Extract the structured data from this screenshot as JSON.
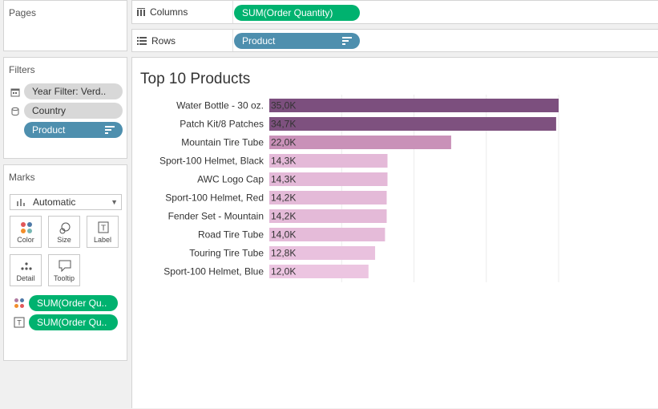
{
  "pages": {
    "title": "Pages"
  },
  "filters": {
    "title": "Filters",
    "items": [
      {
        "label": "Year Filter: Verd..",
        "icon": "calendar-filter-icon"
      },
      {
        "label": "Country",
        "icon": "database-icon"
      },
      {
        "label": "Product",
        "icon": "none",
        "sorted": true
      }
    ]
  },
  "marks": {
    "title": "Marks",
    "mark_type": "Automatic",
    "buttons": [
      {
        "label": "Color",
        "icon": "color-dots-icon"
      },
      {
        "label": "Size",
        "icon": "size-icon"
      },
      {
        "label": "Label",
        "icon": "label-icon"
      },
      {
        "label": "Detail",
        "icon": "detail-icon"
      },
      {
        "label": "Tooltip",
        "icon": "tooltip-icon"
      }
    ],
    "fields": [
      {
        "label": "SUM(Order Qu..",
        "icon": "color-dots-icon"
      },
      {
        "label": "SUM(Order Qu..",
        "icon": "label-text-icon"
      }
    ]
  },
  "shelves": {
    "columns_label": "Columns",
    "columns_pill": "SUM(Order Quantity)",
    "rows_label": "Rows",
    "rows_pill": "Product"
  },
  "colors": {
    "pill_green": "#00b26f",
    "pill_blue": "#4e8fae",
    "bar_dark": "#7c4f7e",
    "bar_mid": "#c88fb7",
    "bar_light": "#ecc5e1"
  },
  "chart_data": {
    "type": "bar",
    "orientation": "horizontal",
    "title": "Top 10 Products",
    "categories": [
      "Water Bottle - 30 oz.",
      "Patch Kit/8 Patches",
      "Mountain Tire Tube",
      "Sport-100 Helmet, Black",
      "AWC Logo Cap",
      "Sport-100 Helmet, Red",
      "Fender Set - Mountain",
      "Road Tire Tube",
      "Touring Tire Tube",
      "Sport-100 Helmet, Blue"
    ],
    "values": [
      35000,
      34700,
      22000,
      14300,
      14300,
      14200,
      14200,
      14000,
      12800,
      12000
    ],
    "data_labels": [
      "35,0K",
      "34,7K",
      "22,0K",
      "14,3K",
      "14,3K",
      "14,2K",
      "14,2K",
      "14,0K",
      "12,8K",
      "12,0K"
    ],
    "xlim": [
      0,
      35000
    ],
    "grid": true,
    "color_encoding": "SUM(Order Quantity)"
  }
}
